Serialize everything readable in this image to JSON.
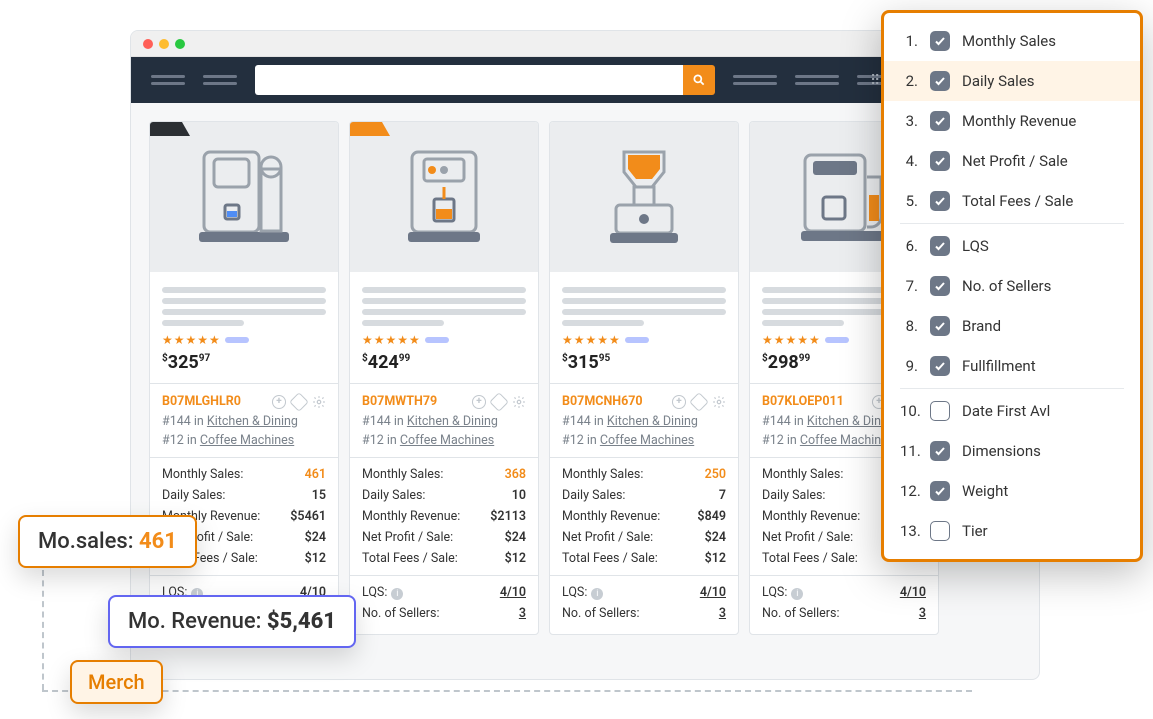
{
  "search": {
    "placeholder": ""
  },
  "products": [
    {
      "flag_color": "#2b2f33",
      "price_main": "325",
      "price_sub": "97",
      "asin": "B07MLGHLR0",
      "rank1": "#144 in ",
      "cat1": "Kitchen & Dining",
      "rank2": "#12 in ",
      "cat2": "Coffee Machines",
      "metrics": [
        {
          "l": "Monthly Sales:",
          "v": "461",
          "orange": true
        },
        {
          "l": "Daily Sales:",
          "v": "15"
        },
        {
          "l": "Monthly Revenue:",
          "v": "$5461"
        },
        {
          "l": "Net Profit / Sale:",
          "v": "$24"
        },
        {
          "l": "Total Fees / Sale:",
          "v": "$12"
        }
      ],
      "foot": [
        {
          "l": "LQS:",
          "v": "4/10",
          "info": true
        },
        {
          "l": "No. of Sellers:",
          "v": "3"
        }
      ]
    },
    {
      "flag_color": "#f28c1a",
      "price_main": "424",
      "price_sub": "99",
      "asin": "B07MWTH79",
      "rank1": "#144 in ",
      "cat1": "Kitchen & Dining",
      "rank2": "#12 in ",
      "cat2": "Coffee Machines",
      "metrics": [
        {
          "l": "Monthly Sales:",
          "v": "368",
          "orange": true
        },
        {
          "l": "Daily Sales:",
          "v": "10"
        },
        {
          "l": "Monthly Revenue:",
          "v": "$2113"
        },
        {
          "l": "Net Profit / Sale:",
          "v": "$24"
        },
        {
          "l": "Total Fees / Sale:",
          "v": "$12"
        }
      ],
      "foot": [
        {
          "l": "LQS:",
          "v": "4/10",
          "info": true
        },
        {
          "l": "No. of Sellers:",
          "v": "3"
        }
      ]
    },
    {
      "flag_color": "",
      "price_main": "315",
      "price_sub": "95",
      "asin": "B07MCNH670",
      "rank1": "#144 in ",
      "cat1": "Kitchen & Dining",
      "rank2": "#12 in ",
      "cat2": "Coffee Machines",
      "metrics": [
        {
          "l": "Monthly Sales:",
          "v": "250",
          "orange": true
        },
        {
          "l": "Daily Sales:",
          "v": "7"
        },
        {
          "l": "Monthly Revenue:",
          "v": "$849"
        },
        {
          "l": "Net Profit / Sale:",
          "v": "$24"
        },
        {
          "l": "Total Fees / Sale:",
          "v": "$12"
        }
      ],
      "foot": [
        {
          "l": "LQS:",
          "v": "4/10",
          "info": true
        },
        {
          "l": "No. of Sellers:",
          "v": "3"
        }
      ]
    },
    {
      "flag_color": "",
      "price_main": "298",
      "price_sub": "99",
      "asin": "B07KLOEP011",
      "rank1": "#144 in ",
      "cat1": "Kitchen & Dining",
      "rank2": "#12 in ",
      "cat2": "Coffee Machines",
      "metrics": [
        {
          "l": "Monthly Sales:",
          "v": "",
          "orange": true
        },
        {
          "l": "Daily Sales:",
          "v": ""
        },
        {
          "l": "Monthly Revenue:",
          "v": ""
        },
        {
          "l": "Net Profit / Sale:",
          "v": ""
        },
        {
          "l": "Total Fees / Sale:",
          "v": ""
        }
      ],
      "foot": [
        {
          "l": "LQS:",
          "v": "4/10",
          "info": true
        },
        {
          "l": "No. of Sellers:",
          "v": "3"
        }
      ]
    }
  ],
  "config": [
    {
      "n": "1.",
      "label": "Monthly Sales",
      "checked": true
    },
    {
      "n": "2.",
      "label": "Daily Sales",
      "checked": true,
      "highlight": true,
      "grip": true
    },
    {
      "n": "3.",
      "label": "Monthly Revenue",
      "checked": true
    },
    {
      "n": "4.",
      "label": "Net Profit / Sale",
      "checked": true
    },
    {
      "n": "5.",
      "label": "Total Fees / Sale",
      "checked": true,
      "sep": true
    },
    {
      "n": "6.",
      "label": "LQS",
      "checked": true
    },
    {
      "n": "7.",
      "label": "No. of Sellers",
      "checked": true
    },
    {
      "n": "8.",
      "label": "Brand",
      "checked": true
    },
    {
      "n": "9.",
      "label": "Fullfillment",
      "checked": true,
      "sep": true
    },
    {
      "n": "10.",
      "label": "Date First Avl",
      "checked": false
    },
    {
      "n": "11.",
      "label": "Dimensions",
      "checked": true
    },
    {
      "n": "12.",
      "label": "Weight",
      "checked": true
    },
    {
      "n": "13.",
      "label": "Tier",
      "checked": false
    }
  ],
  "callouts": {
    "sales_label": "Mo.sales: ",
    "sales_value": "461",
    "revenue_label": "Mo. Revenue: ",
    "revenue_value": "$5,461",
    "tag": "Merch"
  }
}
